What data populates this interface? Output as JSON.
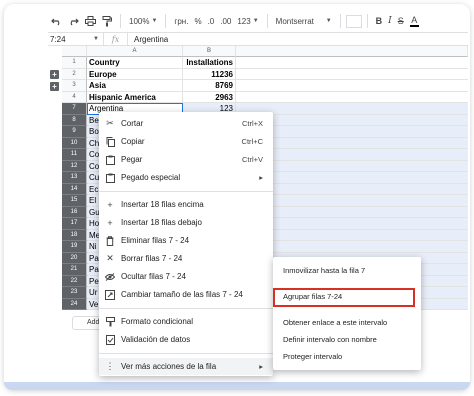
{
  "toolbar": {
    "zoom": "100%",
    "currency": "грн.",
    "percent": "%",
    "decimal_dec": ".0",
    "decimal_inc": ".00",
    "more_formats": "123",
    "font": "Montserrat",
    "bold": "B",
    "italic": "I",
    "strike": "S",
    "text_color": "A"
  },
  "formula_bar": {
    "cell_ref": "7:24",
    "fx": "fx",
    "value": "Argentina"
  },
  "columns": [
    "A",
    "B"
  ],
  "rows": [
    {
      "n": "1",
      "a": "Country",
      "b": "Installations",
      "bold": true
    },
    {
      "n": "2",
      "a": "Europe",
      "b": "11236",
      "bold": true
    },
    {
      "n": "3",
      "a": "Asia",
      "b": "8769",
      "bold": true
    },
    {
      "n": "4",
      "a": "Hispanic America",
      "b": "2963",
      "bold": true
    },
    {
      "n": "7",
      "a": "Argentina",
      "b": "123",
      "bold": false
    },
    {
      "n": "8",
      "a": "Be",
      "b": "",
      "bold": false
    },
    {
      "n": "9",
      "a": "Bo",
      "b": "",
      "bold": false
    },
    {
      "n": "10",
      "a": "Ch",
      "b": "",
      "bold": false
    },
    {
      "n": "11",
      "a": "Co",
      "b": "",
      "bold": false
    },
    {
      "n": "12",
      "a": "Co",
      "b": "",
      "bold": false
    },
    {
      "n": "13",
      "a": "Cu",
      "b": "",
      "bold": false
    },
    {
      "n": "14",
      "a": "Ec",
      "b": "",
      "bold": false
    },
    {
      "n": "15",
      "a": "El",
      "b": "",
      "bold": false
    },
    {
      "n": "16",
      "a": "Gu",
      "b": "",
      "bold": false
    },
    {
      "n": "17",
      "a": "Ho",
      "b": "",
      "bold": false
    },
    {
      "n": "18",
      "a": "Me",
      "b": "",
      "bold": false
    },
    {
      "n": "19",
      "a": "Ni",
      "b": "",
      "bold": false
    },
    {
      "n": "20",
      "a": "Pa",
      "b": "",
      "bold": false
    },
    {
      "n": "21",
      "a": "Pa",
      "b": "",
      "bold": false
    },
    {
      "n": "22",
      "a": "Pe",
      "b": "",
      "bold": false
    },
    {
      "n": "23",
      "a": "Ur",
      "b": "",
      "bold": false
    },
    {
      "n": "24",
      "a": "Ve",
      "b": "",
      "bold": false
    }
  ],
  "add_button": "Add",
  "context_menu": {
    "cut": {
      "label": "Cortar",
      "shortcut": "Ctrl+X"
    },
    "copy": {
      "label": "Copiar",
      "shortcut": "Ctrl+C"
    },
    "paste": {
      "label": "Pegar",
      "shortcut": "Ctrl+V"
    },
    "paste_special": {
      "label": "Pegado especial",
      "arrow": "▸"
    },
    "insert_above": "Insertar 18 filas encima",
    "insert_below": "Insertar 18 filas debajo",
    "delete_rows": "Eliminar filas 7 - 24",
    "clear_rows": "Borrar filas 7 - 24",
    "hide_rows": "Ocultar filas 7 - 24",
    "resize_rows": "Cambiar tamaño de las filas 7 - 24",
    "conditional_format": "Formato condicional",
    "data_validation": "Validación de datos",
    "more_actions": {
      "label": "Ver más acciones de la fila",
      "arrow": "▸"
    }
  },
  "submenu": {
    "freeze": "Inmovilizar hasta la fila 7",
    "group": "Agrupar filas 7-24",
    "get_link": "Obtener enlace a este intervalo",
    "named_range": "Definir intervalo con nombre",
    "protect": "Proteger intervalo"
  },
  "colors": {
    "highlight": "#d93025",
    "selection": "#e8eef9",
    "selected_header": "#5f6368"
  }
}
